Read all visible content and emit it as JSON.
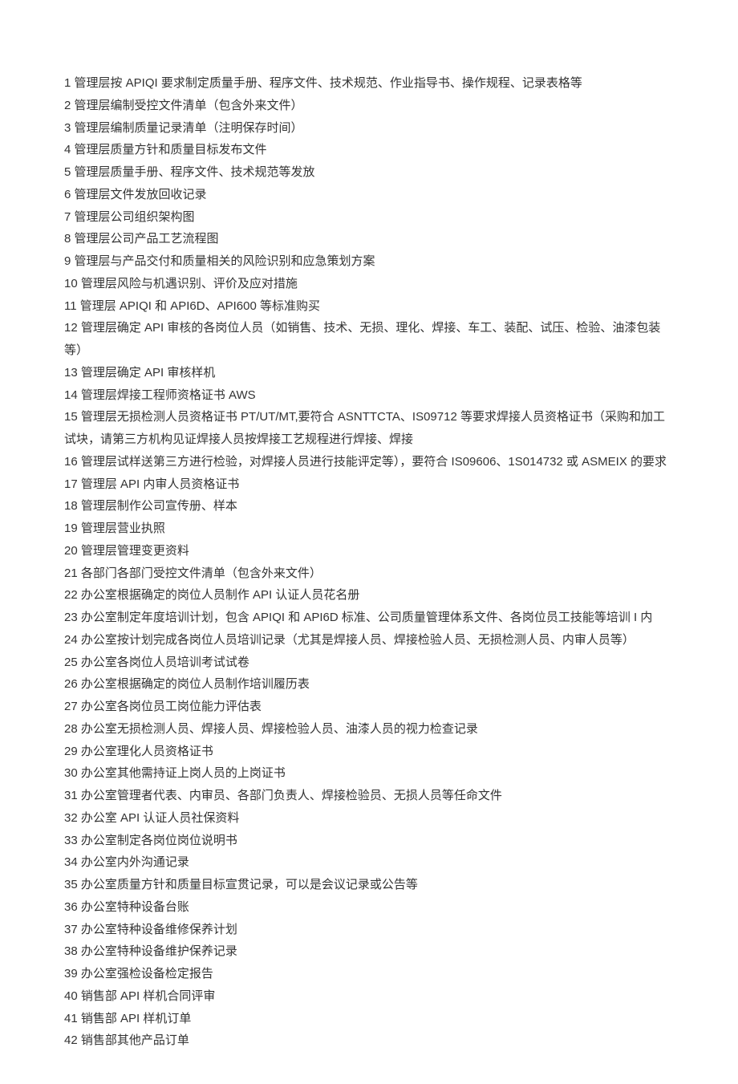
{
  "lines": [
    "1 管理层按 APIQI 要求制定质量手册、程序文件、技术规范、作业指导书、操作规程、记录表格等",
    "2 管理层编制受控文件清单（包含外来文件）",
    "3 管理层编制质量记录清单（注明保存时间）",
    "4 管理层质量方针和质量目标发布文件",
    "5 管理层质量手册、程序文件、技术规范等发放",
    "6 管理层文件发放回收记录",
    "7 管理层公司组织架构图",
    "8 管理层公司产品工艺流程图",
    "9 管理层与产品交付和质量相关的风险识别和应急策划方案",
    "10 管理层风险与机遇识别、评价及应对措施",
    "11 管理层 APIQI 和 API6D、API600 等标准购买",
    "12 管理层确定 API 审核的各岗位人员（如销售、技术、无损、理化、焊接、车工、装配、试压、检验、油漆包装等）",
    "13 管理层确定 API 审核样机",
    "14 管理层焊接工程师资格证书 AWS",
    "15 管理层无损检测人员资格证书 PT/UT/MT,要符合 ASNTTCTA、IS09712 等要求焊接人员资格证书（采购和加工试块，请第三方机构见证焊接人员按焊接工艺规程进行焊接、焊接",
    "16 管理层试样送第三方进行检验，对焊接人员进行技能评定等），要符合 IS09606、1S014732 或 ASMEIX 的要求",
    "17 管理层 API 内审人员资格证书",
    "18 管理层制作公司宣传册、样本",
    "19 管理层营业执照",
    "20 管理层管理变更资料",
    "21 各部门各部门受控文件清单（包含外来文件）",
    "22 办公室根据确定的岗位人员制作 API 认证人员花名册",
    "23 办公室制定年度培训计划，包含 APIQI 和 API6D 标准、公司质量管理体系文件、各岗位员工技能等培训 I 内",
    "24 办公室按计划完成各岗位人员培训记录（尤其是焊接人员、焊接检验人员、无损检测人员、内审人员等）",
    "25 办公室各岗位人员培训考试试卷",
    "26 办公室根据确定的岗位人员制作培训履历表",
    "27 办公室各岗位员工岗位能力评估表",
    "28 办公室无损检测人员、焊接人员、焊接检验人员、油漆人员的视力检查记录",
    "29 办公室理化人员资格证书",
    "30 办公室其他需持证上岗人员的上岗证书",
    "31 办公室管理者代表、内审员、各部门负责人、焊接检验员、无损人员等任命文件",
    "32 办公室 API 认证人员社保资料",
    "33 办公室制定各岗位岗位说明书",
    "34 办公室内外沟通记录",
    "35 办公室质量方针和质量目标宣贯记录，可以是会议记录或公告等",
    "36 办公室特种设备台账",
    "37 办公室特种设备维修保养计划",
    "38 办公室特种设备维护保养记录",
    "39 办公室强检设备检定报告",
    "40 销售部 API 样机合同评审",
    "41 销售部 API 样机订单",
    "42 销售部其他产品订单"
  ]
}
